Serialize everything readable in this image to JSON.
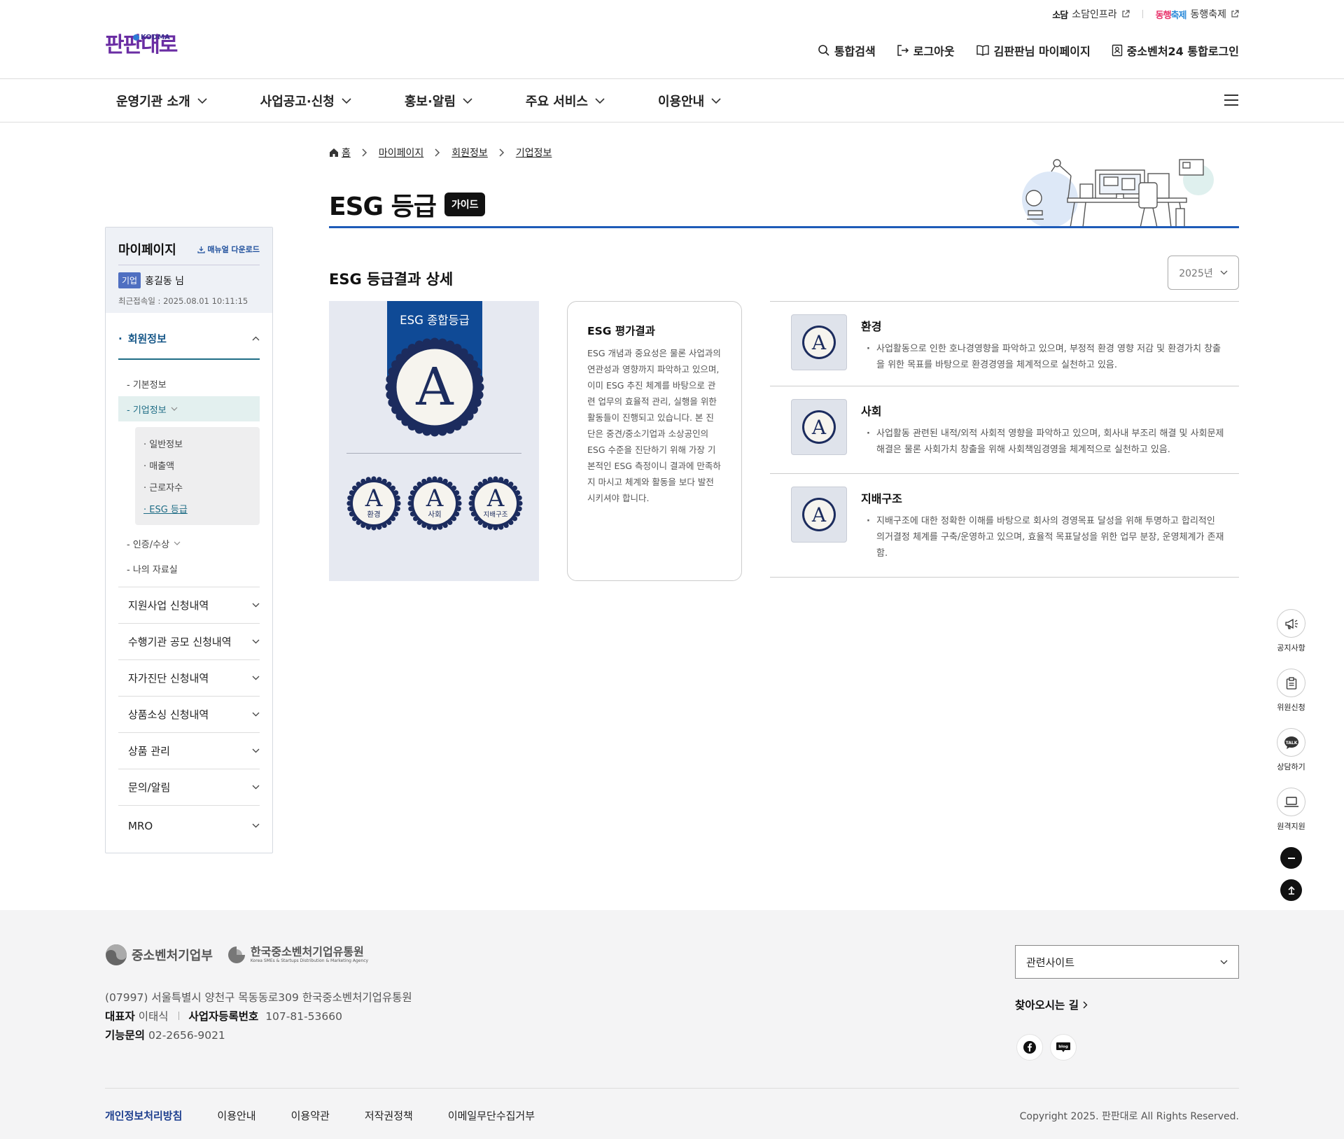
{
  "util": {
    "sodam_logo": "소담",
    "sodam_label": "소담인프라",
    "dh_logo_a": "동행",
    "dh_logo_b": "축제",
    "dh_label": "동행축제"
  },
  "header": {
    "logo_text": "판판대로",
    "logo_sub": "KODMA",
    "search": "통합검색",
    "logout": "로그아웃",
    "mypage": "김판판님 마이페이지",
    "sso": "중소벤처24 통합로그인"
  },
  "gnb": [
    "운영기관 소개",
    "사업공고·신청",
    "홍보·알림",
    "주요 서비스",
    "이용안내"
  ],
  "breadcrumb": [
    "홈",
    "마이페이지",
    "회원정보",
    "기업정보"
  ],
  "page": {
    "title": "ESG 등급",
    "guide": "가이드",
    "section_title": "ESG 등급결과 상세",
    "year": "2025년"
  },
  "sidebar": {
    "title": "마이페이지",
    "manual": "매뉴얼 다운로드",
    "user_badge": "기업",
    "user_name": "홍길동 님",
    "last_login": "최근접속일 : 2025.08.01 10:11:15",
    "active_menu": "회원정보",
    "sub": [
      "- 기본정보",
      "- 기업정보",
      "- 인증/수상",
      "- 나의 자료실"
    ],
    "sub_sub": [
      "· 일반정보",
      "· 매출액",
      "· 근로자수",
      "· ESG 등급"
    ],
    "menus": [
      "지원사업 신청내역",
      "수행기관 공모 신청내역",
      "자가진단 신청내역",
      "상품소싱 신청내역",
      "상품 관리",
      "문의/알림",
      "MRO"
    ]
  },
  "grade": {
    "ribbon_label": "ESG 종합등급",
    "overall": "A",
    "subs": [
      {
        "grade": "A",
        "label": "환경"
      },
      {
        "grade": "A",
        "label": "사회"
      },
      {
        "grade": "A",
        "label": "지배구조"
      }
    ]
  },
  "eval": {
    "title": "ESG 평가결과",
    "text": "ESG 개념과 중요성은 물론 사업과의 연관성과 영향까지 파악하고 있으며, 이미 ESG 추진 체계를 바탕으로 관련 업무의 효율적 관리, 실행을 위한 활동들이 진행되고 있습니다. 본 진단은 중견/중소기업과 소상공인의 ESG 수준을 진단하기 위해 가장 기본적인 ESG 측정이니 결과에 만족하지 마시고 체계와 활동을 보다 발전시키셔야 합니다."
  },
  "items": [
    {
      "grade": "A",
      "title": "환경",
      "desc": "사업활동으로 인한 호나경영향을 파악하고 있으며, 부정적 환경 영향 저감 및 환경가치 창출을 위한 목표를 바탕으로 환경경영을 체계적으로 실천하고 있음."
    },
    {
      "grade": "A",
      "title": "사회",
      "desc": "사업활동 관련된 내적/외적 사회적 영향을 파악하고 있으며, 회사내 부조리 해결 및 사회문제 해결은 물론 사회가치 창출을 위해 사회책임경영을 체계적으로 실천하고 있음."
    },
    {
      "grade": "A",
      "title": "지배구조",
      "desc": "지배구조에 대한 정확한 이해를 바탕으로 회사의 경영목표 달성을 위해 투명하고 합리적인 의거결정 체계를 구축/운영하고 있으며, 효율적 목표달성을 위한 업무 분장, 운영체계가 존재함."
    }
  ],
  "quick": [
    "공지사항",
    "위원신청",
    "상담하기",
    "원격지원"
  ],
  "footer": {
    "logo1": "중소벤처기업부",
    "logo2": "한국중소벤처기업유통원",
    "logo2_en": "Korea SMEs & Startups Distribution & Marketing Agency",
    "address": "(07997) 서울특별시 양천구 목동동로309 한국중소벤처기업유통원",
    "ceo_label": "대표자",
    "ceo": "이태식",
    "biz_label": "사업자등록번호",
    "biz": "107-81-53660",
    "tel_label": "기능문의",
    "tel": "02-2656-9021",
    "related": "관련사이트",
    "directions": "찾아오시는 길",
    "blog": "blog",
    "links": [
      "개인정보처리방침",
      "이용안내",
      "이용약관",
      "저작권정책",
      "이메일무단수집거부"
    ],
    "copyright": "Copyright 2025. 판판대로 All Rights Reserved."
  }
}
